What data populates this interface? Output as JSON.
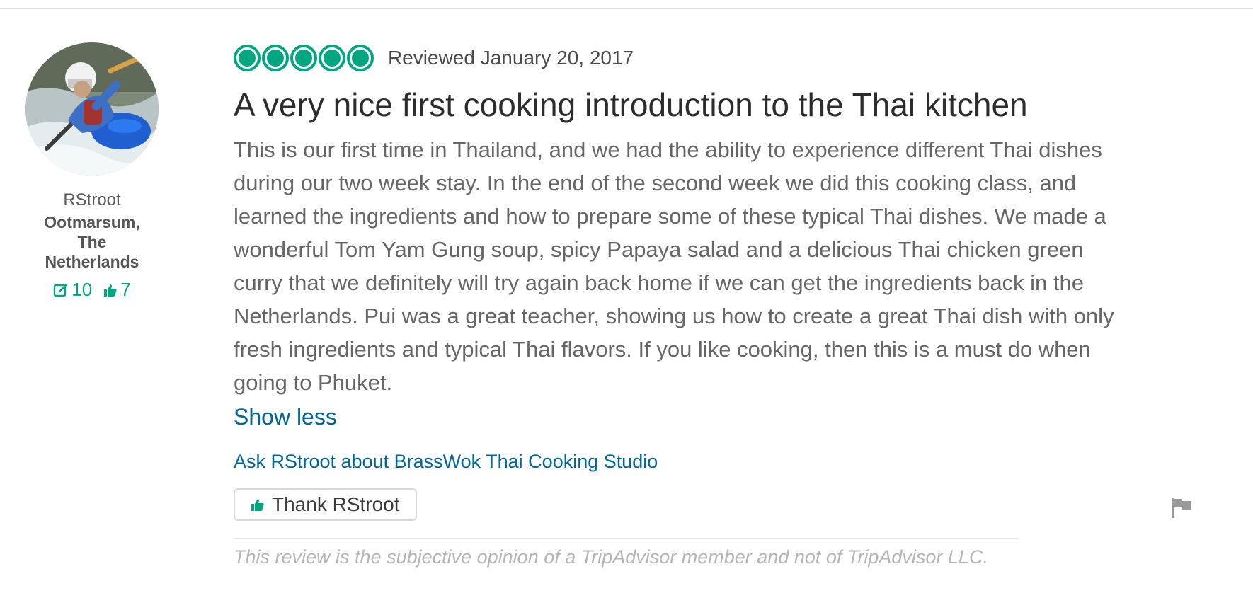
{
  "member": {
    "avatar_icon": "kayaker-avatar",
    "name": "RStroot",
    "location": "Ootmarsum, The Netherlands",
    "review_count": "10",
    "helpful_votes": "7"
  },
  "review": {
    "rating": 5,
    "rating_max": 5,
    "date": "Reviewed January 20, 2017",
    "title": "A very nice first cooking introduction to the Thai kitchen",
    "body": "This is our first time in Thailand, and we had the ability to experience different Thai dishes during our two week stay. In the end of the second week we did this cooking class, and learned the ingredients and how to prepare some of these typical Thai dishes. We made a wonderful Tom Yam Gung soup, spicy Papaya salad and a delicious Thai chicken green curry that we definitely will try again back home if we can get the ingredients back in the Netherlands. Pui was a great teacher, showing us how to create a great Thai dish with only fresh ingredients and typical Thai flavors. If you like cooking, then this is a must do when going to Phuket.",
    "show_less": "Show less",
    "ask_link": "Ask RStroot about BrassWok Thai Cooking Studio",
    "thank_button": "Thank RStroot",
    "disclaimer": "This review is the subjective opinion of a TripAdvisor member and not of TripAdvisor LLC."
  },
  "colors": {
    "brand_green": "#00a680",
    "link_blue": "#006699"
  },
  "icons": {
    "rating": "bubble-rating-icon",
    "reviews": "pencil-edit-icon",
    "helpful": "thumbs-up-icon",
    "report": "flag-icon"
  }
}
